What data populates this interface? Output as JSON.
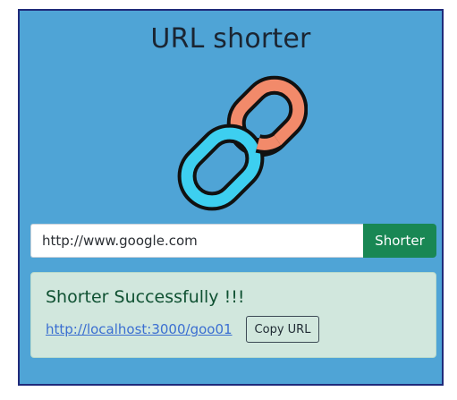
{
  "header": {
    "title": "URL shorter"
  },
  "logo": {
    "icon": "chain-link-icon",
    "colors": {
      "left_link": "#3dcff0",
      "right_link": "#f28a6a",
      "outline": "#111111"
    }
  },
  "form": {
    "url_value": "http://www.google.com",
    "submit_label": "Shorter"
  },
  "result": {
    "message": "Shorter Successfully !!!",
    "short_url": "http://localhost:3000/goo01",
    "copy_label": "Copy URL"
  },
  "colors": {
    "background": "#4fa4d6",
    "border": "#1f2a7a",
    "submit_button": "#198754",
    "alert_background": "#d1e7dd",
    "alert_text": "#0f5132",
    "link": "#3b6fd1"
  }
}
